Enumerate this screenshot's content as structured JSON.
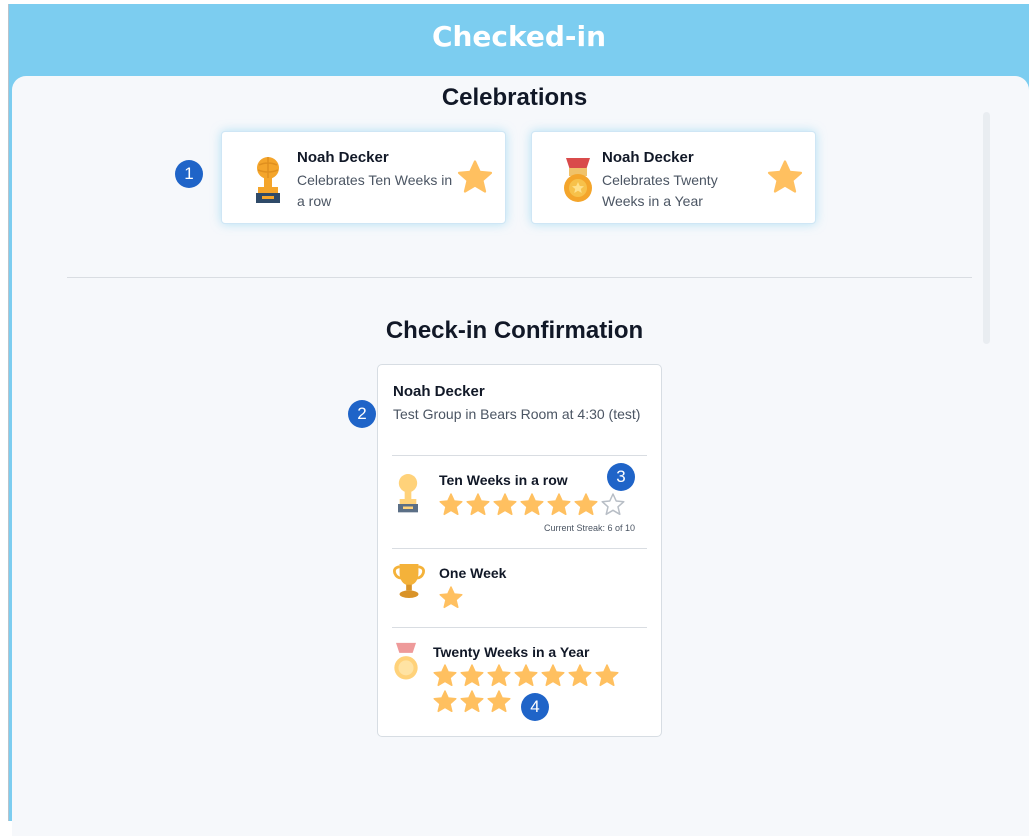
{
  "header": {
    "title": "Checked-in"
  },
  "celebrations": {
    "title": "Celebrations",
    "marker": "1",
    "cards": [
      {
        "name": "Noah Decker",
        "text": "Celebrates Ten Weeks in a row",
        "icon": "trophy-icon"
      },
      {
        "name": "Noah Decker",
        "text": "Celebrates Twenty Weeks in a Year",
        "icon": "medal-icon"
      }
    ]
  },
  "confirmation": {
    "title": "Check-in Confirmation",
    "marker": "2",
    "name": "Noah Decker",
    "description": "Test Group in Bears Room at 4:30 (test)",
    "achievements": [
      {
        "title": "Ten Weeks in a row",
        "icon": "trophy-icon",
        "stars_filled": 6,
        "stars_total": 7,
        "streak_text": "Current Streak: 6 of 10",
        "marker": "3"
      },
      {
        "title": "One Week",
        "icon": "cup-icon",
        "stars_filled": 1,
        "stars_total": 1
      },
      {
        "title": "Twenty Weeks in a Year",
        "icon": "medal-icon",
        "stars_filled": 10,
        "stars_total": 10,
        "marker": "4"
      }
    ]
  },
  "colors": {
    "header": "#7ccdf0",
    "marker": "#1f64c8",
    "star": "#ffc060",
    "panel": "#f6f8fb"
  }
}
